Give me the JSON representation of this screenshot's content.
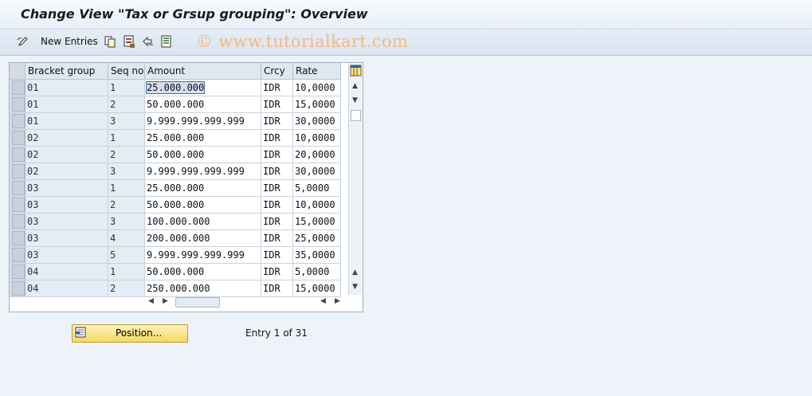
{
  "window": {
    "title": "Change View \"Tax or Grsup grouping\": Overview",
    "watermark": "© www.tutorialkart.com"
  },
  "toolbar": {
    "new_entries_label": "New Entries",
    "icons": [
      "edit-pencil-icon",
      "copy-icon",
      "save-icon",
      "undo-icon",
      "details-icon"
    ]
  },
  "table": {
    "columns": [
      "Bracket group",
      "Seq no",
      "Amount",
      "Crcy",
      "Rate"
    ],
    "rows": [
      [
        "01",
        "1",
        "25.000.000",
        "IDR",
        "10,0000"
      ],
      [
        "01",
        "2",
        "50.000.000",
        "IDR",
        "15,0000"
      ],
      [
        "01",
        "3",
        "9.999.999.999.999",
        "IDR",
        "30,0000"
      ],
      [
        "02",
        "1",
        "25.000.000",
        "IDR",
        "10,0000"
      ],
      [
        "02",
        "2",
        "50.000.000",
        "IDR",
        "20,0000"
      ],
      [
        "02",
        "3",
        "9.999.999.999.999",
        "IDR",
        "30,0000"
      ],
      [
        "03",
        "1",
        "25.000.000",
        "IDR",
        "5,0000"
      ],
      [
        "03",
        "2",
        "50.000.000",
        "IDR",
        "10,0000"
      ],
      [
        "03",
        "3",
        "100.000.000",
        "IDR",
        "15,0000"
      ],
      [
        "03",
        "4",
        "200.000.000",
        "IDR",
        "25,0000"
      ],
      [
        "03",
        "5",
        "9.999.999.999.999",
        "IDR",
        "35,0000"
      ],
      [
        "04",
        "1",
        "50.000.000",
        "IDR",
        "5,0000"
      ],
      [
        "04",
        "2",
        "250.000.000",
        "IDR",
        "15,0000"
      ]
    ]
  },
  "footer": {
    "position_label": "Position...",
    "entry_text": "Entry 1 of 31"
  },
  "colors": {
    "title_bg": "#f4f8fc",
    "key_cell": "#e3edf6",
    "button_yellow": "#f4d965"
  }
}
